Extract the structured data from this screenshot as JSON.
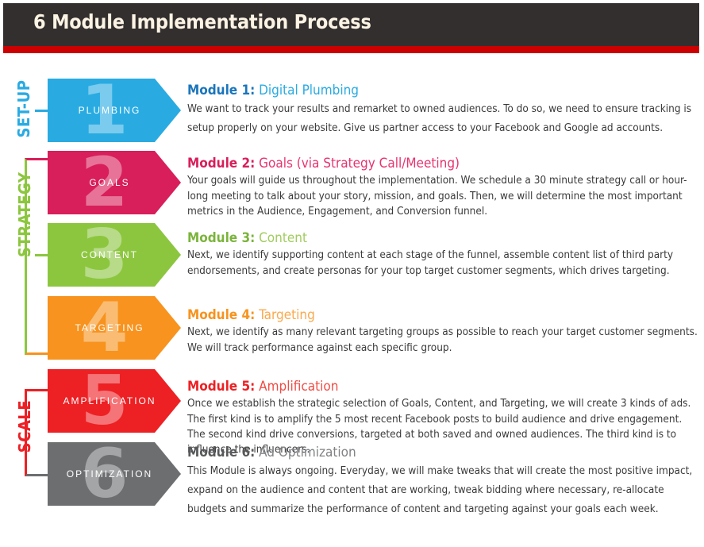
{
  "header": {
    "title": "6 Module Implementation Process",
    "bar_color": "#332F2E",
    "title_color": "#FBF3E4",
    "accent_color": "#CC0000"
  },
  "stages": [
    {
      "name": "set-up",
      "label": "SET-UP",
      "color": "#29ABE2"
    },
    {
      "name": "strategy",
      "label": "STRATEGY",
      "color": "#8CC63F"
    },
    {
      "name": "scale",
      "label": "SCALE",
      "color": "#ED2024"
    }
  ],
  "modules": [
    {
      "number": "1",
      "arrow_label": "PLUMBING",
      "color": "#29ABE2",
      "heading_label": "Module 1:",
      "heading_title": " Digital Plumbing",
      "body": "We want to track your results and remarket to owned audiences. To do so, we need to ensure tracking is setup properly on your website. Give us partner access to your Facebook and Google ad accounts."
    },
    {
      "number": "2",
      "arrow_label": "GOALS",
      "color": "#D81E5B",
      "heading_label": "Module 2:",
      "heading_title": " Goals (via Strategy Call/Meeting)",
      "body": "Your goals will guide us throughout the implementation. We schedule a 30 minute strategy call or hour-long meeting to talk about your story, mission, and goals. Then, we will determine the most important metrics in the Audience, Engagement, and Conversion funnel."
    },
    {
      "number": "3",
      "arrow_label": "CONTENT",
      "color": "#8CC63F",
      "heading_label": "Module 3:",
      "heading_title": " Content",
      "body": "Next, we identify supporting content at each stage of the funnel, assemble content list of third party endorsements, and create personas for your top target customer segments, which drives targeting."
    },
    {
      "number": "4",
      "arrow_label": "TARGETING",
      "color": "#F7931E",
      "heading_label": "Module 4:",
      "heading_title": " Targeting",
      "body": "Next, we identify as many relevant targeting groups as possible to reach your target customer segments. We will track performance against each specific group."
    },
    {
      "number": "5",
      "arrow_label": "AMPLIFICATION",
      "color": "#ED2024",
      "heading_label": "Module 5:",
      "heading_title": " Amplification",
      "body": "Once we establish the strategic selection of Goals, Content, and Targeting, we will create 3 kinds of ads. The first kind is to amplify the 5 most recent Facebook posts to build audience and drive engagement. The second kind drive conversions, targeted at both saved and owned audiences. The third kind is to influence the influencers."
    },
    {
      "number": "6",
      "arrow_label": "OPTIMIZATION",
      "color": "#6D6E70",
      "heading_label": "Module 6:",
      "heading_title": " Ad Optimization",
      "body": "This Module is always ongoing. Everyday, we will make tweaks that will create the most positive impact, expand on the audience and content that are working, tweak bidding where necessary, re-allocate budgets and summarize the performance of content and targeting against your goals each week."
    }
  ]
}
